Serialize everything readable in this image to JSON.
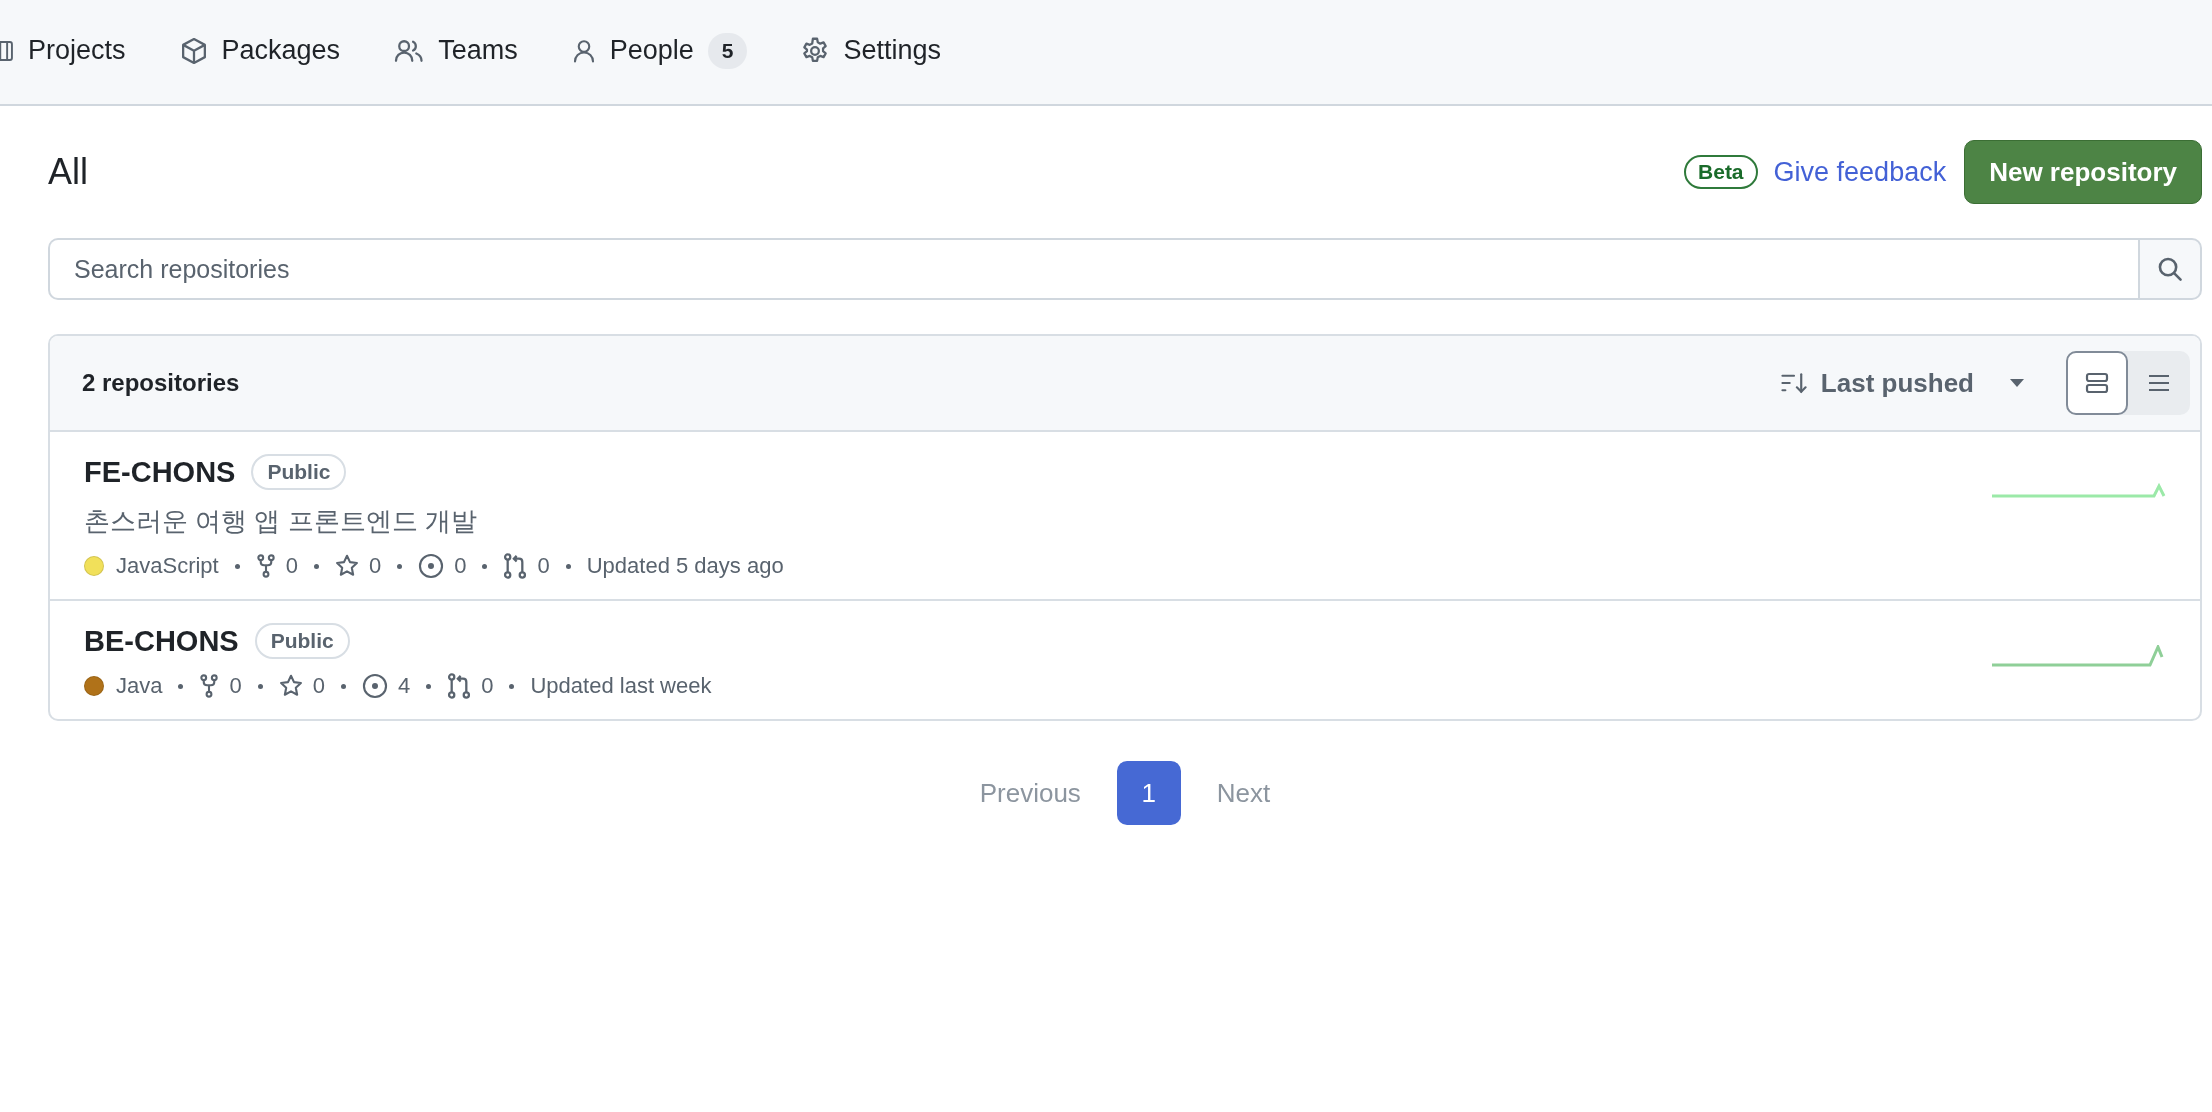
{
  "nav": {
    "items": [
      {
        "label": "Projects",
        "kind": "table",
        "selected": false
      },
      {
        "label": "Packages",
        "kind": "package",
        "selected": false
      },
      {
        "label": "Teams",
        "kind": "people",
        "selected": false
      },
      {
        "label": "People",
        "kind": "person",
        "counter": "5",
        "selected": false
      },
      {
        "label": "Settings",
        "kind": "gear",
        "selected": false
      }
    ]
  },
  "header": {
    "title": "All",
    "beta_label": "Beta",
    "feedback_link": "Give feedback",
    "new_button": "New repository"
  },
  "search": {
    "placeholder": "Search repositories"
  },
  "list": {
    "count": "2 repositories",
    "sort": {
      "label": "Last pushed"
    },
    "view_toggle": [
      {
        "kind": "cards",
        "selected": true
      },
      {
        "kind": "list",
        "selected": false
      }
    ],
    "repositories": [
      {
        "name": "FE-CHONS",
        "visibility": "Public",
        "description": "촌스러운 여행 앱 프론트엔드 개발",
        "language": "JavaScript",
        "color": "#f1e05a",
        "forks": "0",
        "stars": "0",
        "issues": "0",
        "pulls": "0",
        "updated": "Updated 5 days ago"
      },
      {
        "name": "BE-CHONS",
        "visibility": "Public",
        "language": "Java",
        "color": "#b07219",
        "forks": "0",
        "stars": "0",
        "issues": "4",
        "pulls": "0",
        "updated": "Updated last week"
      }
    ]
  },
  "pagination": {
    "previous": {
      "label": "Previous",
      "disabled": true
    },
    "pages": [
      {
        "label": "1",
        "selected": true
      }
    ],
    "next": {
      "label": "Next",
      "disabled": true
    }
  }
}
